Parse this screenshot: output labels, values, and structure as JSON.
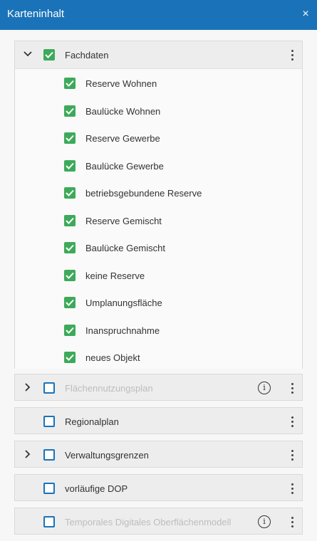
{
  "window": {
    "title": "Karteninhalt",
    "close_glyph": "×"
  },
  "colors": {
    "titlebar": "#1a73b8",
    "checkbox_checked": "#3daa5a",
    "checkbox_border": "#1a73b8",
    "disabled_text": "#bdbdbd"
  },
  "groups": [
    {
      "label": "Fachdaten",
      "checked": true,
      "expanded": true,
      "chevron": "chevron-down-icon",
      "disabled": false,
      "children": [
        {
          "label": "Reserve Wohnen",
          "checked": true
        },
        {
          "label": "Baulücke Wohnen",
          "checked": true
        },
        {
          "label": "Reserve Gewerbe",
          "checked": true
        },
        {
          "label": "Baulücke Gewerbe",
          "checked": true
        },
        {
          "label": "betriebsgebundene Reserve",
          "checked": true
        },
        {
          "label": "Reserve Gemischt",
          "checked": true
        },
        {
          "label": "Baulücke Gemischt",
          "checked": true
        },
        {
          "label": "keine Reserve",
          "checked": true
        },
        {
          "label": "Umplanungsfläche",
          "checked": true
        },
        {
          "label": "Inanspruchnahme",
          "checked": true
        },
        {
          "label": "neues Objekt",
          "checked": true
        }
      ]
    },
    {
      "label": "Flächennutzungsplan",
      "checked": false,
      "expanded": false,
      "chevron": "chevron-right-icon",
      "disabled": true,
      "info": true
    },
    {
      "label": "Regionalplan",
      "checked": false,
      "expanded": false,
      "chevron": null,
      "disabled": false
    },
    {
      "label": "Verwaltungsgrenzen",
      "checked": false,
      "expanded": false,
      "chevron": "chevron-right-icon",
      "disabled": false
    },
    {
      "label": "vorläufige DOP",
      "checked": false,
      "expanded": false,
      "chevron": null,
      "disabled": false
    },
    {
      "label": "Temporales Digitales Oberflächenmodell",
      "checked": false,
      "expanded": false,
      "chevron": null,
      "disabled": true,
      "info": true
    }
  ],
  "icons": {
    "info": "info-icon",
    "menu": "kebab-menu-icon"
  },
  "info_glyph": "i"
}
